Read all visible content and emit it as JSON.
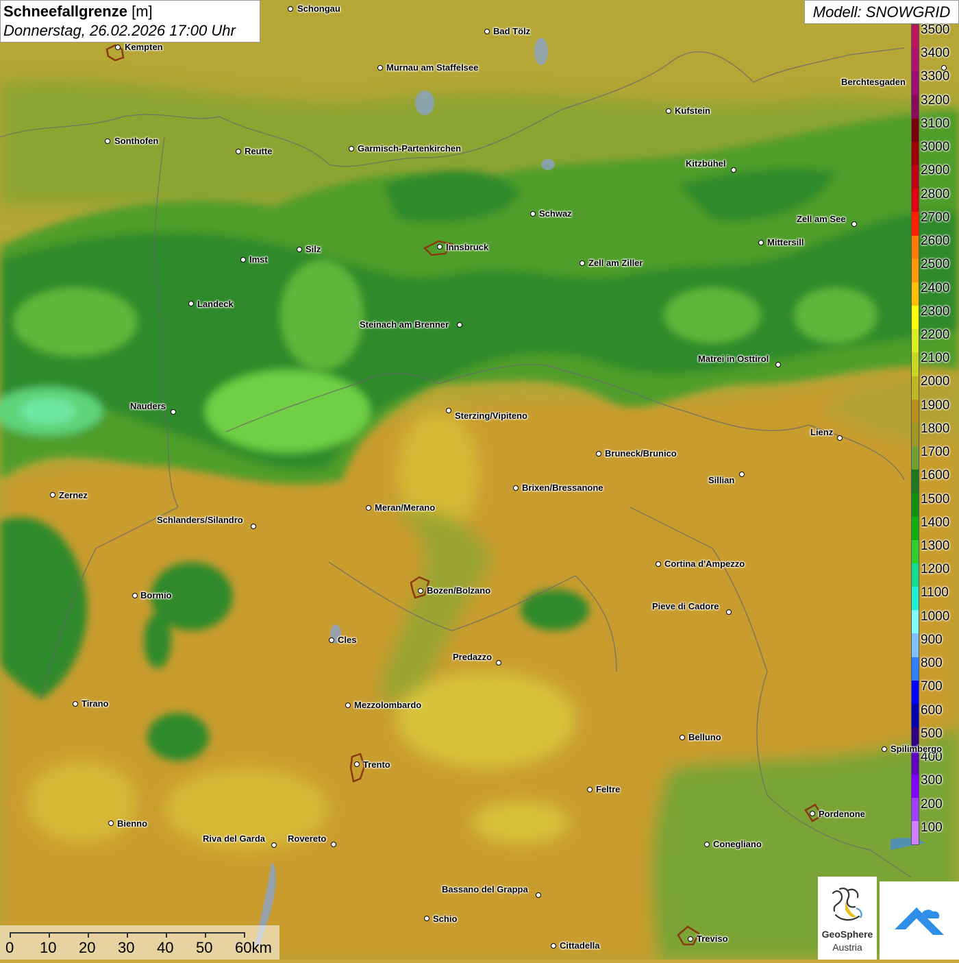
{
  "title": {
    "parameter": "Schneefallgrenze",
    "unit": "[m]",
    "datetime": "Donnerstag, 26.02.2026 17:00 Uhr"
  },
  "model_label": "Modell: SNOWGRID",
  "legend": {
    "values": [
      "3500",
      "3400",
      "3300",
      "3200",
      "3100",
      "3000",
      "2900",
      "2800",
      "2700",
      "2600",
      "2500",
      "2400",
      "2300",
      "2200",
      "2100",
      "2000",
      "1900",
      "1800",
      "1700",
      "1600",
      "1500",
      "1400",
      "1300",
      "1200",
      "1100",
      "1000",
      "900",
      "800",
      "700",
      "600",
      "500",
      "400",
      "300",
      "200",
      "100"
    ],
    "colors": [
      "#c0145a",
      "#b0106a",
      "#a00c72",
      "#8a0a5a",
      "#7a0000",
      "#a00000",
      "#c00010",
      "#e00010",
      "#ff2000",
      "#ff7a00",
      "#ff9a00",
      "#ffc000",
      "#ffff00",
      "#d8f020",
      "#c8d820",
      "#c0b820",
      "#b8901a",
      "#a09a20",
      "#70a030",
      "#207820",
      "#109010",
      "#10b010",
      "#30d030",
      "#10e090",
      "#20f0d0",
      "#80ffff",
      "#80c0ff",
      "#3080ff",
      "#0000ff",
      "#0000b0",
      "#300080",
      "#6000c0",
      "#8000ff",
      "#a040ff",
      "#d080ff"
    ]
  },
  "cities": [
    {
      "name": "Schongau",
      "dot": [
        424,
        13
      ],
      "label": [
        434,
        5
      ]
    },
    {
      "name": "Kempten",
      "dot": [
        172,
        69
      ],
      "label": [
        182,
        61
      ]
    },
    {
      "name": "Bad Tölz",
      "dot": [
        711,
        46
      ],
      "label": [
        720,
        38
      ]
    },
    {
      "name": "Murnau am Staffelsee",
      "dot": [
        555,
        99
      ],
      "label": [
        564,
        91
      ]
    },
    {
      "name": "Berchtesgaden",
      "dot": [
        1378,
        99
      ],
      "label": [
        1228,
        112
      ]
    },
    {
      "name": "Kufstein",
      "dot": [
        976,
        162
      ],
      "label": [
        985,
        154
      ]
    },
    {
      "name": "Sonthofen",
      "dot": [
        157,
        206
      ],
      "label": [
        167,
        198
      ]
    },
    {
      "name": "Reutte",
      "dot": [
        348,
        221
      ],
      "label": [
        357,
        213
      ]
    },
    {
      "name": "Garmisch-Partenkirchen",
      "dot": [
        513,
        217
      ],
      "label": [
        522,
        209
      ]
    },
    {
      "name": "Kitzbühel",
      "dot": [
        1071,
        248
      ],
      "label": [
        1001,
        231
      ]
    },
    {
      "name": "Schwaz",
      "dot": [
        778,
        312
      ],
      "label": [
        787,
        304
      ]
    },
    {
      "name": "Zell am See",
      "dot": [
        1247,
        327
      ],
      "label": [
        1163,
        312
      ]
    },
    {
      "name": "Mittersill",
      "dot": [
        1111,
        354
      ],
      "label": [
        1120,
        346
      ]
    },
    {
      "name": "Innsbruck",
      "dot": [
        642,
        360
      ],
      "label": [
        651,
        353
      ]
    },
    {
      "name": "Silz",
      "dot": [
        437,
        364
      ],
      "label": [
        446,
        356
      ]
    },
    {
      "name": "Imst",
      "dot": [
        355,
        379
      ],
      "label": [
        364,
        371
      ]
    },
    {
      "name": "Zell am Ziller",
      "dot": [
        850,
        384
      ],
      "label": [
        859,
        376
      ]
    },
    {
      "name": "Landeck",
      "dot": [
        279,
        443
      ],
      "label": [
        288,
        436
      ]
    },
    {
      "name": "Steinach am Brenner",
      "dot": [
        671,
        474
      ],
      "label": [
        525,
        466
      ]
    },
    {
      "name": "Matrei in Osttirol",
      "dot": [
        1136,
        532
      ],
      "label": [
        1019,
        516
      ]
    },
    {
      "name": "Nauders",
      "dot": [
        253,
        601
      ],
      "label": [
        190,
        585
      ]
    },
    {
      "name": "Sterzing/Vipiteno",
      "dot": [
        655,
        599
      ],
      "label": [
        664,
        599
      ]
    },
    {
      "name": "Lienz",
      "dot": [
        1226,
        639
      ],
      "label": [
        1183,
        623
      ]
    },
    {
      "name": "Bruneck/Brunico",
      "dot": [
        874,
        662
      ],
      "label": [
        883,
        654
      ]
    },
    {
      "name": "Sillian",
      "dot": [
        1083,
        692
      ],
      "label": [
        1034,
        693
      ]
    },
    {
      "name": "Brixen/Bressanone",
      "dot": [
        753,
        712
      ],
      "label": [
        762,
        704
      ]
    },
    {
      "name": "Zernez",
      "dot": [
        77,
        722
      ],
      "label": [
        86,
        715
      ]
    },
    {
      "name": "Meran/Merano",
      "dot": [
        538,
        741
      ],
      "label": [
        547,
        733
      ]
    },
    {
      "name": "Schlanders/Silandro",
      "dot": [
        370,
        768
      ],
      "label": [
        229,
        751
      ]
    },
    {
      "name": "Cortina d'Ampezzo",
      "dot": [
        961,
        823
      ],
      "label": [
        970,
        815
      ]
    },
    {
      "name": "Bozen/Bolzano",
      "dot": [
        614,
        862
      ],
      "label": [
        623,
        854
      ]
    },
    {
      "name": "Bormio",
      "dot": [
        197,
        869
      ],
      "label": [
        205,
        861
      ]
    },
    {
      "name": "Pieve di Cadore",
      "dot": [
        1064,
        893
      ],
      "label": [
        952,
        877
      ]
    },
    {
      "name": "Cles",
      "dot": [
        484,
        934
      ],
      "label": [
        493,
        926
      ]
    },
    {
      "name": "Predazzo",
      "dot": [
        728,
        967
      ],
      "label": [
        661,
        951
      ]
    },
    {
      "name": "Tirano",
      "dot": [
        110,
        1027
      ],
      "label": [
        119,
        1019
      ]
    },
    {
      "name": "Mezzolombardo",
      "dot": [
        508,
        1029
      ],
      "label": [
        517,
        1021
      ]
    },
    {
      "name": "Belluno",
      "dot": [
        996,
        1076
      ],
      "label": [
        1005,
        1068
      ]
    },
    {
      "name": "Spilimbergo",
      "dot": [
        1291,
        1093
      ],
      "label": [
        1300,
        1085
      ]
    },
    {
      "name": "Trento",
      "dot": [
        521,
        1115
      ],
      "label": [
        530,
        1108
      ]
    },
    {
      "name": "Feltre",
      "dot": [
        861,
        1152
      ],
      "label": [
        870,
        1144
      ]
    },
    {
      "name": "Pordenone",
      "dot": [
        1186,
        1187
      ],
      "label": [
        1195,
        1180
      ]
    },
    {
      "name": "Bienno",
      "dot": [
        162,
        1201
      ],
      "label": [
        171,
        1194
      ]
    },
    {
      "name": "Riva del Garda",
      "dot": [
        400,
        1233
      ],
      "label": [
        296,
        1216
      ]
    },
    {
      "name": "Rovereto",
      "dot": [
        487,
        1232
      ],
      "label": [
        420,
        1216
      ]
    },
    {
      "name": "Conegliano",
      "dot": [
        1032,
        1232
      ],
      "label": [
        1041,
        1224
      ]
    },
    {
      "name": "Bassano del Grappa",
      "dot": [
        786,
        1306
      ],
      "label": [
        645,
        1290
      ]
    },
    {
      "name": "Schio",
      "dot": [
        623,
        1340
      ],
      "label": [
        632,
        1333
      ]
    },
    {
      "name": "Treviso",
      "dot": [
        1008,
        1370
      ],
      "label": [
        1017,
        1362
      ]
    },
    {
      "name": "Cittadella",
      "dot": [
        808,
        1380
      ],
      "label": [
        817,
        1372
      ]
    }
  ],
  "scalebar": {
    "labels": [
      "0",
      "10",
      "20",
      "30",
      "40",
      "50",
      "60km"
    ]
  },
  "logo": {
    "name_line1": "GeoSphere",
    "name_line2": "Austria"
  }
}
